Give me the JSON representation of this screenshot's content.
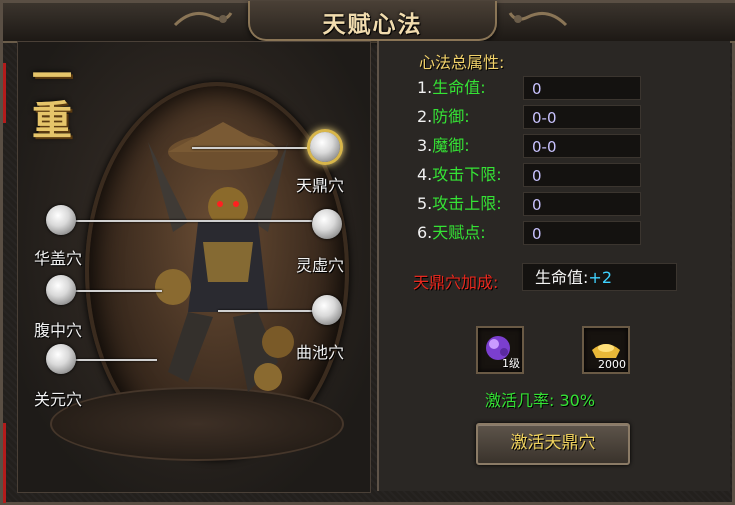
{
  "window": {
    "title": "天赋心法"
  },
  "left": {
    "level_glyphs": [
      "一",
      "重"
    ],
    "acupoints": [
      {
        "label": "天鼎穴",
        "active": true
      },
      {
        "label": "华盖穴",
        "active": false
      },
      {
        "label": "灵虚穴",
        "active": false
      },
      {
        "label": "腹中穴",
        "active": false
      },
      {
        "label": "曲池穴",
        "active": false
      },
      {
        "label": "关元穴",
        "active": false
      }
    ]
  },
  "right": {
    "title": "心法总属性:",
    "attributes": [
      {
        "num": "1.",
        "name": "生命值:",
        "value": "0"
      },
      {
        "num": "2.",
        "name": "防御:",
        "value": "0-0"
      },
      {
        "num": "3.",
        "name": "魔御:",
        "value": "0-0"
      },
      {
        "num": "4.",
        "name": "攻击下限:",
        "value": "0"
      },
      {
        "num": "5.",
        "name": "攻击上限:",
        "value": "0"
      },
      {
        "num": "6.",
        "name": "天赋点:",
        "value": "0"
      }
    ],
    "bonus": {
      "label": "天鼎穴加成:",
      "stat": "生命值:",
      "value": "+2"
    },
    "items": [
      {
        "icon": "purple-gem-icon",
        "label": "1级"
      },
      {
        "icon": "gold-ingot-icon",
        "label": "2000"
      }
    ],
    "rate": "激活几率: 30%",
    "activate_button": "激活天鼎穴"
  },
  "colors": {
    "title": "#f1dcae",
    "attr_name": "#35e335",
    "bonus_label": "#e8281e",
    "button_text": "#f1d35e"
  }
}
